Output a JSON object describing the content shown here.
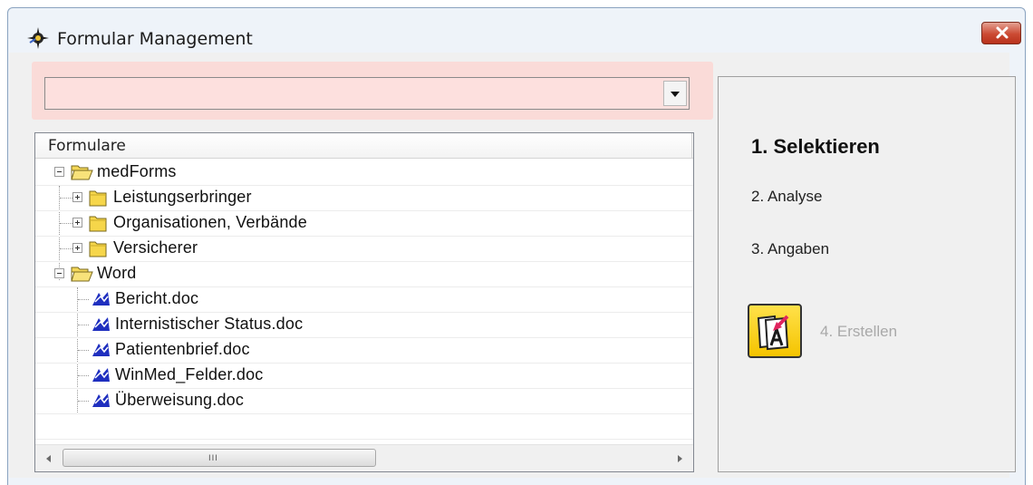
{
  "window": {
    "title": "Formular Management"
  },
  "search": {
    "value": ""
  },
  "tree": {
    "header": "Formulare",
    "nodes": [
      {
        "label": "medForms",
        "type": "folder-open",
        "expander": "minus",
        "level": 0
      },
      {
        "label": "Leistungserbringer",
        "type": "folder",
        "expander": "plus",
        "level": 1
      },
      {
        "label": "Organisationen, Verbände",
        "type": "folder",
        "expander": "plus",
        "level": 1
      },
      {
        "label": "Versicherer",
        "type": "folder",
        "expander": "plus",
        "level": 1
      },
      {
        "label": "Word",
        "type": "folder-open",
        "expander": "minus",
        "level": 0
      },
      {
        "label": "Bericht.doc",
        "type": "document",
        "level": 1
      },
      {
        "label": "Internistischer Status.doc",
        "type": "document",
        "level": 1
      },
      {
        "label": "Patientenbrief.doc",
        "type": "document",
        "level": 1
      },
      {
        "label": "WinMed_Felder.doc",
        "type": "document",
        "level": 1
      },
      {
        "label": "Überweisung.doc",
        "type": "document",
        "level": 1
      }
    ]
  },
  "steps": {
    "step1": "1. Selektieren",
    "step2": "2. Analyse",
    "step3": "3. Angaben",
    "step4": "4. Erstellen"
  },
  "colors": {
    "search_bg": "#fadbd8",
    "create_button": "#f5c400",
    "folder": "#f6d64a",
    "document_icon": "#1f2fbf"
  },
  "icons": {
    "app": "app-icon",
    "close": "close-icon",
    "combo": "chevron-down-icon",
    "create": "create-form-icon"
  }
}
